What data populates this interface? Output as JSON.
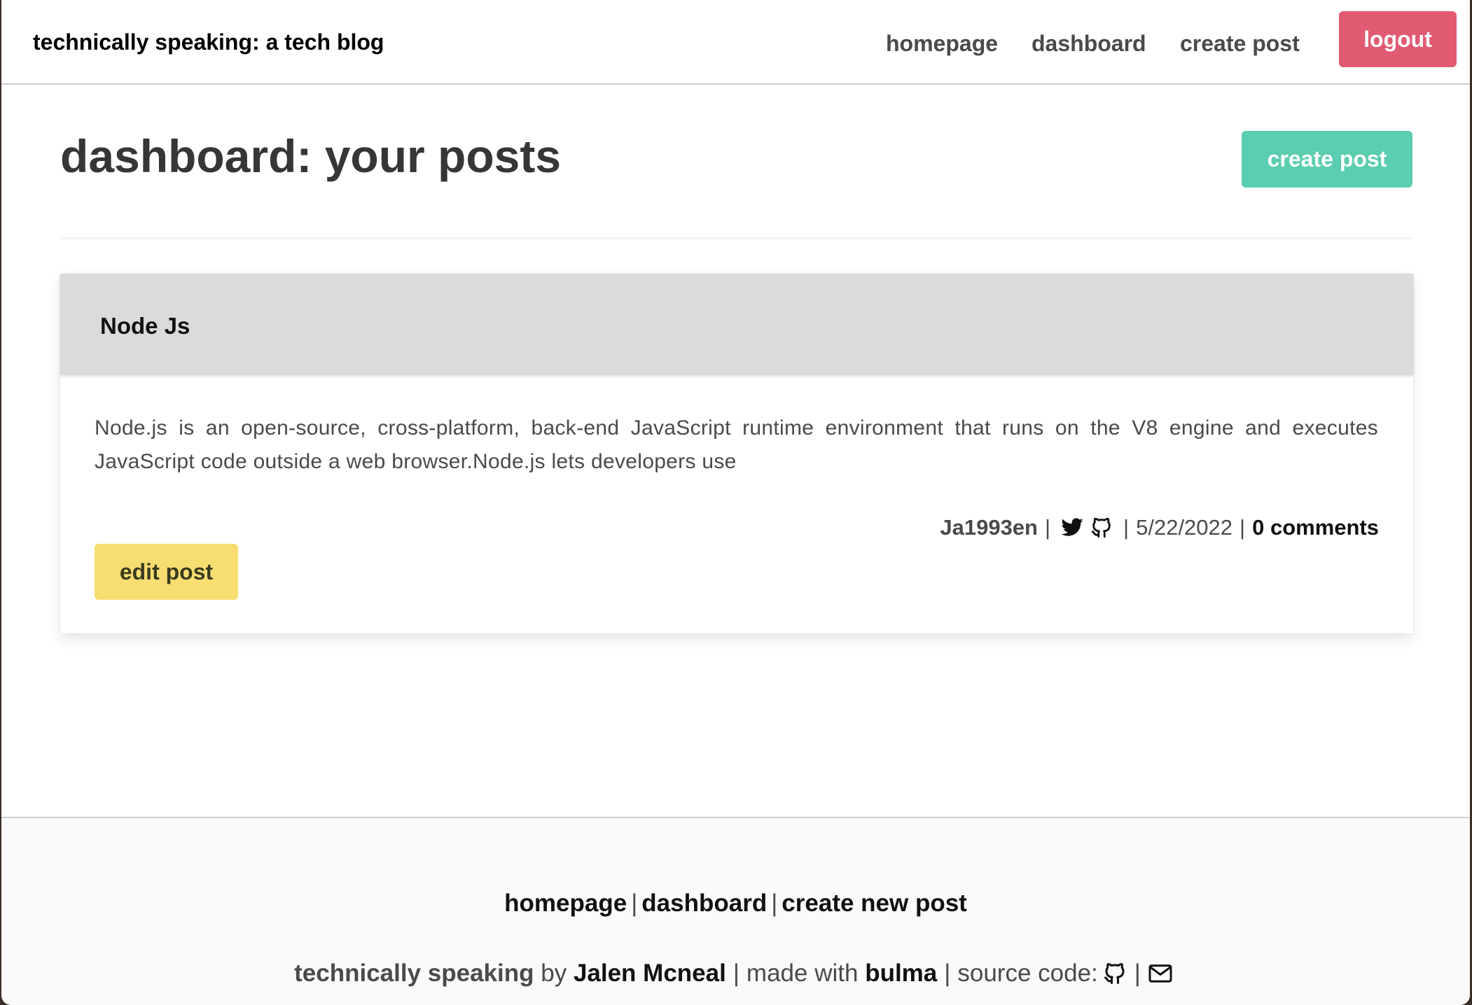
{
  "navbar": {
    "brand": "technically speaking: a tech blog",
    "links": {
      "homepage": "homepage",
      "dashboard": "dashboard",
      "create_post": "create post"
    },
    "logout_label": "logout"
  },
  "main": {
    "title": "dashboard: your posts",
    "create_button": "create post"
  },
  "post": {
    "title": "Node Js",
    "body": "Node.js is an open-source, cross-platform, back-end JavaScript runtime environment that runs on the V8 engine and executes JavaScript code outside a web browser.Node.js lets developers use",
    "author": "Ja1993en",
    "date": "5/22/2022",
    "comments": "0 comments",
    "separator": "|",
    "icons": [
      "twitter-icon",
      "github-icon"
    ],
    "edit_button": "edit post"
  },
  "footer": {
    "links": {
      "homepage": "homepage",
      "dashboard": "dashboard",
      "create_new_post": "create new post"
    },
    "separator": "|",
    "credit": {
      "site": "technically speaking",
      "by": "by",
      "author": "Jalen Mcneal",
      "made_with": "made with",
      "framework": "bulma",
      "source_code": "source code:"
    },
    "icons": [
      "github-icon",
      "envelope-icon"
    ]
  },
  "colors": {
    "logout": "#e05b72",
    "create": "#5bcdb0",
    "edit": "#f8de71",
    "card_header": "#dbdbdb",
    "footer_bg": "#fafafa"
  }
}
